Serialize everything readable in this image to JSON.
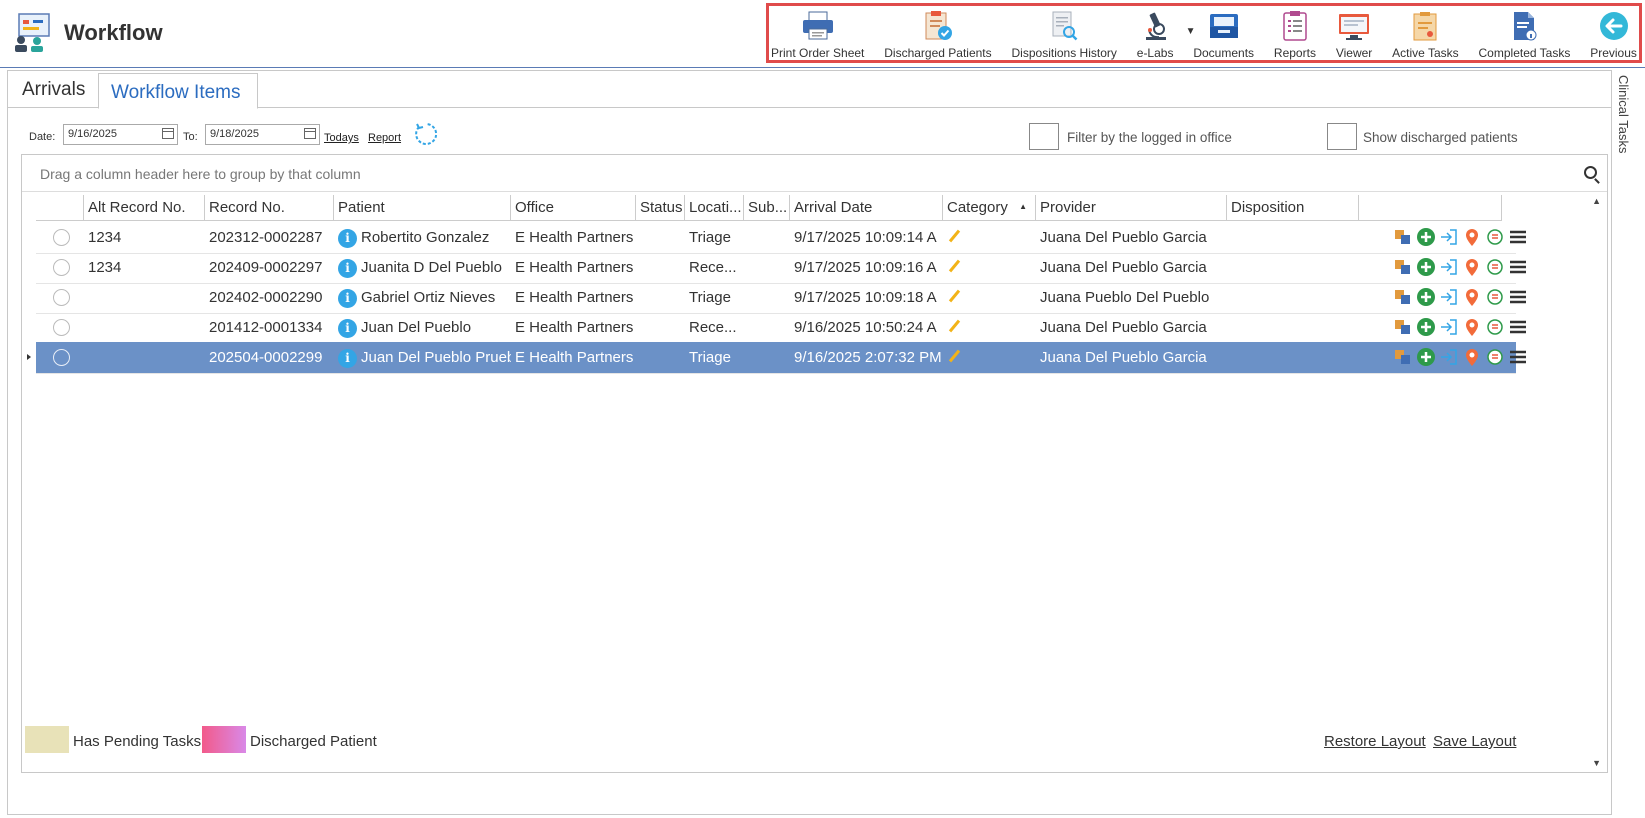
{
  "app": {
    "title": "Workflow"
  },
  "toolbar": {
    "items": [
      {
        "label": "Print Order Sheet",
        "icon": "printer-icon"
      },
      {
        "label": "Discharged Patients",
        "icon": "clipboard-check-icon"
      },
      {
        "label": "Dispositions History",
        "icon": "document-search-icon"
      },
      {
        "label": "e-Labs",
        "icon": "microscope-icon"
      },
      {
        "label": "Documents",
        "icon": "inbox-tray-icon"
      },
      {
        "label": "Reports",
        "icon": "report-clipboard-icon"
      },
      {
        "label": "Viewer",
        "icon": "monitor-icon"
      },
      {
        "label": "Active Tasks",
        "icon": "task-board-icon"
      },
      {
        "label": "Completed Tasks",
        "icon": "completed-document-icon"
      },
      {
        "label": "Previous",
        "icon": "back-arrow-icon"
      }
    ]
  },
  "tabs": {
    "arrivals": "Arrivals",
    "workflow_items": "Workflow Items"
  },
  "filters": {
    "date_label": "Date:",
    "date_from": "9/16/2025",
    "to_label": "To:",
    "date_to": "9/18/2025",
    "todays_link": "Todays",
    "report_link": "Report",
    "filter_office_label": "Filter by the logged in office",
    "show_discharged_label": "Show discharged patients"
  },
  "grid": {
    "group_placeholder": "Drag a column header here to group by that column",
    "columns": [
      "Alt Record No.",
      "Record No.",
      "Patient",
      "Office",
      "Status",
      "Locati...",
      "Sub...",
      "Arrival Date",
      "Category",
      "Provider",
      "Disposition"
    ],
    "rows": [
      {
        "alt": "1234",
        "record": "202312-0002287",
        "patient": "Robertito Gonzalez",
        "office": "E Health Partners",
        "status": "",
        "location": "Triage",
        "sub": "",
        "arrival": "9/17/2025 10:09:14 A",
        "provider": "Juana Del Pueblo Garcia",
        "disposition": "",
        "selected": false
      },
      {
        "alt": "1234",
        "record": "202409-0002297",
        "patient": "Juanita D Del Pueblo",
        "office": "E Health Partners",
        "status": "",
        "location": "Rece...",
        "sub": "",
        "arrival": "9/17/2025 10:09:16 A",
        "provider": "Juana Del Pueblo Garcia",
        "disposition": "",
        "selected": false
      },
      {
        "alt": "",
        "record": "202402-0002290",
        "patient": "Gabriel Ortiz Nieves",
        "office": "E Health Partners",
        "status": "",
        "location": "Triage",
        "sub": "",
        "arrival": "9/17/2025 10:09:18 A",
        "provider": "Juana Pueblo Del Pueblo",
        "disposition": "",
        "selected": false
      },
      {
        "alt": "",
        "record": "201412-0001334",
        "patient": "Juan Del Pueblo",
        "office": "E Health Partners",
        "status": "",
        "location": "Rece...",
        "sub": "",
        "arrival": "9/16/2025 10:50:24 A",
        "provider": "Juana Del Pueblo Garcia",
        "disposition": "",
        "selected": false
      },
      {
        "alt": "",
        "record": "202504-0002299",
        "patient": "Juan Del Pueblo Prueb",
        "office": "E Health Partners",
        "status": "",
        "location": "Triage",
        "sub": "",
        "arrival": "9/16/2025 2:07:32 PM",
        "provider": "Juana Del Pueblo Garcia",
        "disposition": "",
        "selected": true
      }
    ]
  },
  "legend": {
    "pending_label": "Has Pending Tasks",
    "pending_color": "#e8e2b8",
    "discharged_label": "Discharged Patient",
    "discharged_color_start": "#f25a8a",
    "discharged_color_end": "#d989e8"
  },
  "footer": {
    "restore_layout": "Restore Layout",
    "save_layout": "Save Layout"
  },
  "side_panel": {
    "label": "Clinical Tasks"
  },
  "colors": {
    "accent": "#2b6cc0",
    "selected_row": "#6b91c7",
    "toolbar_highlight": "#e04b4b"
  }
}
